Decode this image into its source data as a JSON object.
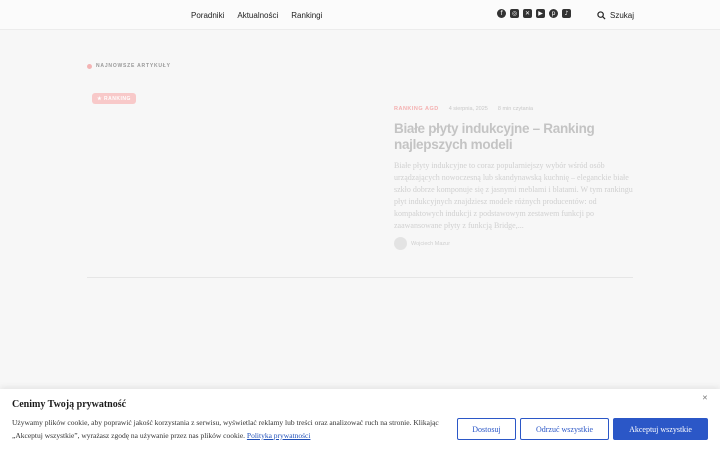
{
  "header": {
    "nav": [
      "Poradniki",
      "Aktualności",
      "Rankingi"
    ],
    "social_icons": [
      "facebook-icon",
      "instagram-icon",
      "x-icon",
      "youtube-icon",
      "pinterest-icon",
      "tiktok-icon"
    ],
    "search_label": "Szukaj"
  },
  "main": {
    "section_label": "NAJNOWSZE ARTYKUŁY",
    "article": {
      "badge": "RANKING",
      "category": "RANKING AGD",
      "date": "4 sierpnia, 2025",
      "read_time": "8 min czytania",
      "title": "Białe płyty indukcyjne – Ranking najlepszych modeli",
      "excerpt": "Białe płyty indukcyjne to coraz popularniejszy wybór wśród osób urządzających nowoczesną lub skandynawską kuchnię – eleganckie białe szkło dobrze komponuje się z jasnymi meblami i blatami. W tym rankingu płyt indukcyjnych znajdziesz modele różnych producentów: od kompaktowych indukcji z podstawowym zestawem funkcji po zaawansowane płyty z funkcją Bridge,...",
      "author": "Wojciech Mazur"
    }
  },
  "cookie": {
    "title": "Cenimy Twoją prywatność",
    "text": "Używamy plików cookie, aby poprawić jakość korzystania z serwisu, wyświetlać reklamy lub treści oraz analizować ruch na stronie. Klikając „Akceptuj wszystkie”, wyrażasz zgodę na używanie przez nas plików cookie.",
    "link": "Polityka prywatności",
    "buttons": {
      "customize": "Dostosuj",
      "reject": "Odrzuć wszystkie",
      "accept": "Akceptuj wszystkie"
    },
    "close_symbol": "✕"
  }
}
